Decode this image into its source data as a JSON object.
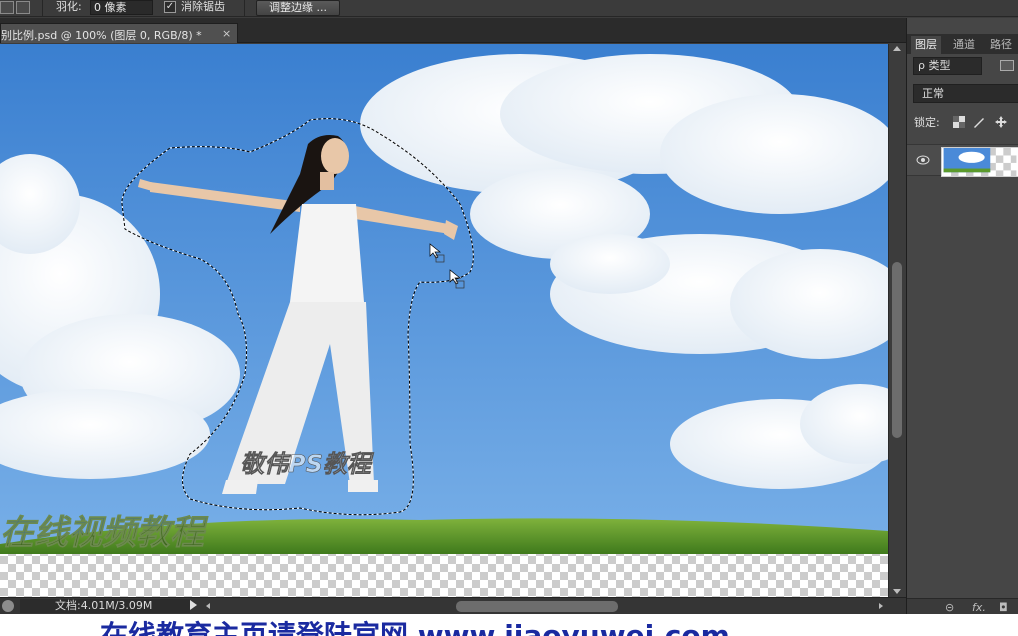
{
  "options_bar": {
    "feather_label": "羽化:",
    "feather_value": "0 像素",
    "antialias_checked": "✓",
    "antialias_label": "消除锯齿",
    "refine_edge_label": "调整边缘 ..."
  },
  "document": {
    "tab_title": "别比例.psd @ 100% (图层 0, RGB/8) *",
    "close_glyph": "×",
    "watermark_center": "敬伟PS教程",
    "watermark_bottom": "在线视频教程"
  },
  "status_bar": {
    "doc_info": "文档:4.01M/3.09M"
  },
  "layers_panel": {
    "tabs": [
      "图层",
      "通道",
      "路径"
    ],
    "active_tab": 0,
    "filter_label": "ρ 类型",
    "blend_mode": "正常",
    "lock_label": "锁定:",
    "bottom_icons": [
      "link-icon",
      "fx-icon",
      "mask-icon"
    ],
    "bottom_labels": {
      "link": "⊝",
      "fx": "fx.",
      "mask": "◘"
    }
  },
  "caption": {
    "text": "在线教育主页请登陆官网 www.jiaoyuwei.com"
  },
  "colors": {
    "sky_top": "#3a7fd0",
    "sky_bottom": "#79b0e8",
    "grass": "#5b9a2c",
    "caption_text": "#1a2aa0"
  }
}
